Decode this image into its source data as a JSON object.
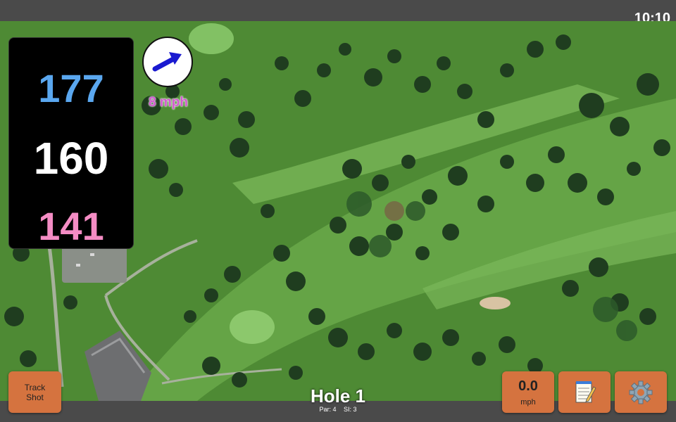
{
  "status": {
    "time": "10:10"
  },
  "yardages": {
    "back": "177",
    "middle": "160",
    "front": "141",
    "back_color": "#5aa7ef",
    "middle_color": "#ffffff",
    "front_color": "#f48cc4"
  },
  "wind": {
    "speed": "8 mph",
    "color": "#d35ad0",
    "icon": "wind-arrow-icon"
  },
  "buttons": {
    "track_shot_line1": "Track",
    "track_shot_line2": "Shot",
    "speed_value": "0.0",
    "speed_unit": "mph",
    "notes_icon": "notepad-icon",
    "settings_icon": "gear-icon",
    "color": "#d5733f"
  },
  "hole": {
    "title": "Hole 1",
    "par_label": "Par: 4",
    "si_label": "SI: 3"
  }
}
